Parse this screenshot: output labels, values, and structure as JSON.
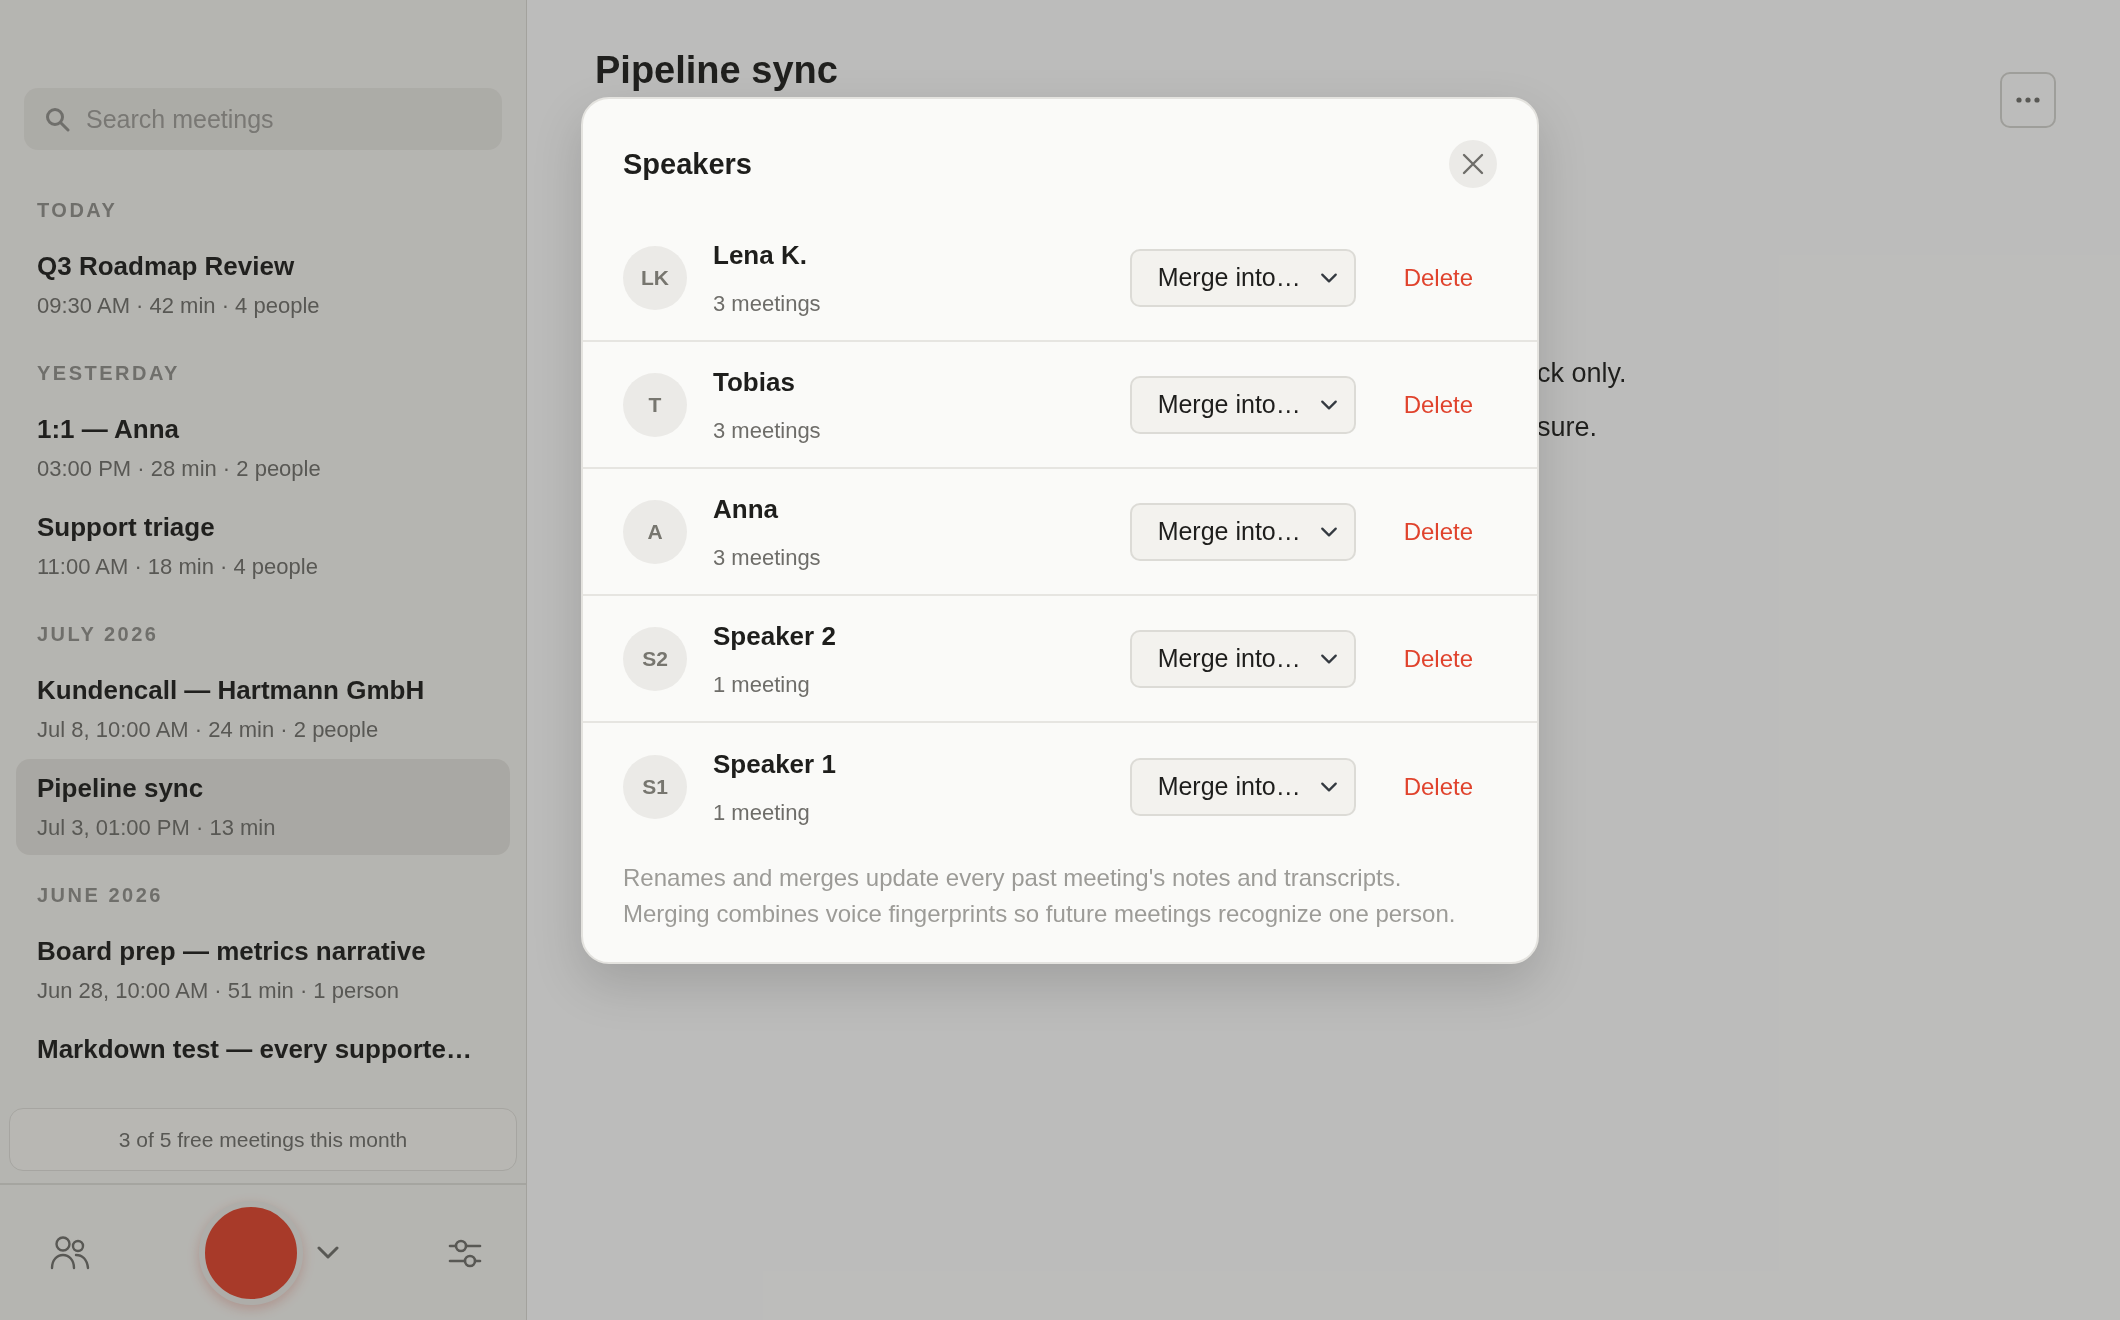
{
  "sidebar": {
    "search": {
      "placeholder": "Search meetings"
    },
    "groups": [
      {
        "label": "TODAY",
        "meetings": [
          {
            "title": "Q3 Roadmap Review",
            "meta": "09:30 AM · 42 min · 4 people",
            "selected": false
          }
        ]
      },
      {
        "label": "YESTERDAY",
        "meetings": [
          {
            "title": "1:1 — Anna",
            "meta": "03:00 PM · 28 min · 2 people",
            "selected": false
          },
          {
            "title": "Support triage",
            "meta": "11:00 AM · 18 min · 4 people",
            "selected": false
          }
        ]
      },
      {
        "label": "JULY 2026",
        "meetings": [
          {
            "title": "Kundencall — Hartmann GmbH",
            "meta": "Jul 8, 10:00 AM · 24 min · 2 people",
            "selected": false
          },
          {
            "title": "Pipeline sync",
            "meta": "Jul 3, 01:00 PM · 13 min",
            "selected": true
          }
        ]
      },
      {
        "label": "JUNE 2026",
        "meetings": [
          {
            "title": "Board prep — metrics narrative",
            "meta": "Jun 28, 10:00 AM · 51 min · 1 person",
            "selected": false
          },
          {
            "title": "Markdown test — every supporte…",
            "selected": false
          }
        ]
      }
    ],
    "usage": "3 of 5 free meetings this month"
  },
  "main": {
    "title": "Pipeline sync",
    "fragments": [
      "ck only.",
      "sure."
    ]
  },
  "dialog": {
    "title": "Speakers",
    "speakers": [
      {
        "initials": "LK",
        "name": "Lena K.",
        "count": "3 meetings",
        "merge": "Merge into…",
        "delete": "Delete"
      },
      {
        "initials": "T",
        "name": "Tobias",
        "count": "3 meetings",
        "merge": "Merge into…",
        "delete": "Delete"
      },
      {
        "initials": "A",
        "name": "Anna",
        "count": "3 meetings",
        "merge": "Merge into…",
        "delete": "Delete"
      },
      {
        "initials": "S2",
        "name": "Speaker 2",
        "count": "1 meeting",
        "merge": "Merge into…",
        "delete": "Delete"
      },
      {
        "initials": "S1",
        "name": "Speaker 1",
        "count": "1 meeting",
        "merge": "Merge into…",
        "delete": "Delete"
      }
    ],
    "note_lines": [
      "Renames and merges update every past meeting's notes and transcripts.",
      "Merging combines voice fingerprints so future meetings recognize one person."
    ]
  }
}
